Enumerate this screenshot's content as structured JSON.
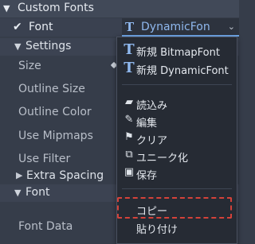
{
  "section": {
    "title": "Custom Fonts"
  },
  "font_row": {
    "label": "Font",
    "value": "DynamicFon"
  },
  "settings": {
    "title": "Settings"
  },
  "properties": [
    "Size",
    "Outline Size",
    "Outline Color",
    "Use Mipmaps",
    "Use Filter"
  ],
  "extra_spacing": {
    "title": "Extra Spacing"
  },
  "font_section": {
    "title": "Font"
  },
  "font_data": {
    "label": "Font Data"
  },
  "menu": {
    "new_bitmap": "新規 BitmapFont",
    "new_dynamic": "新規 DynamicFont",
    "load": "読込み",
    "edit": "編集",
    "clear": "クリア",
    "make_unique": "ユニーク化",
    "save": "保存",
    "copy": "コピー",
    "paste": "貼り付け"
  },
  "colors": {
    "accent": "#8fb8ee",
    "highlight": "#d4423a",
    "background": "#363d4a"
  }
}
